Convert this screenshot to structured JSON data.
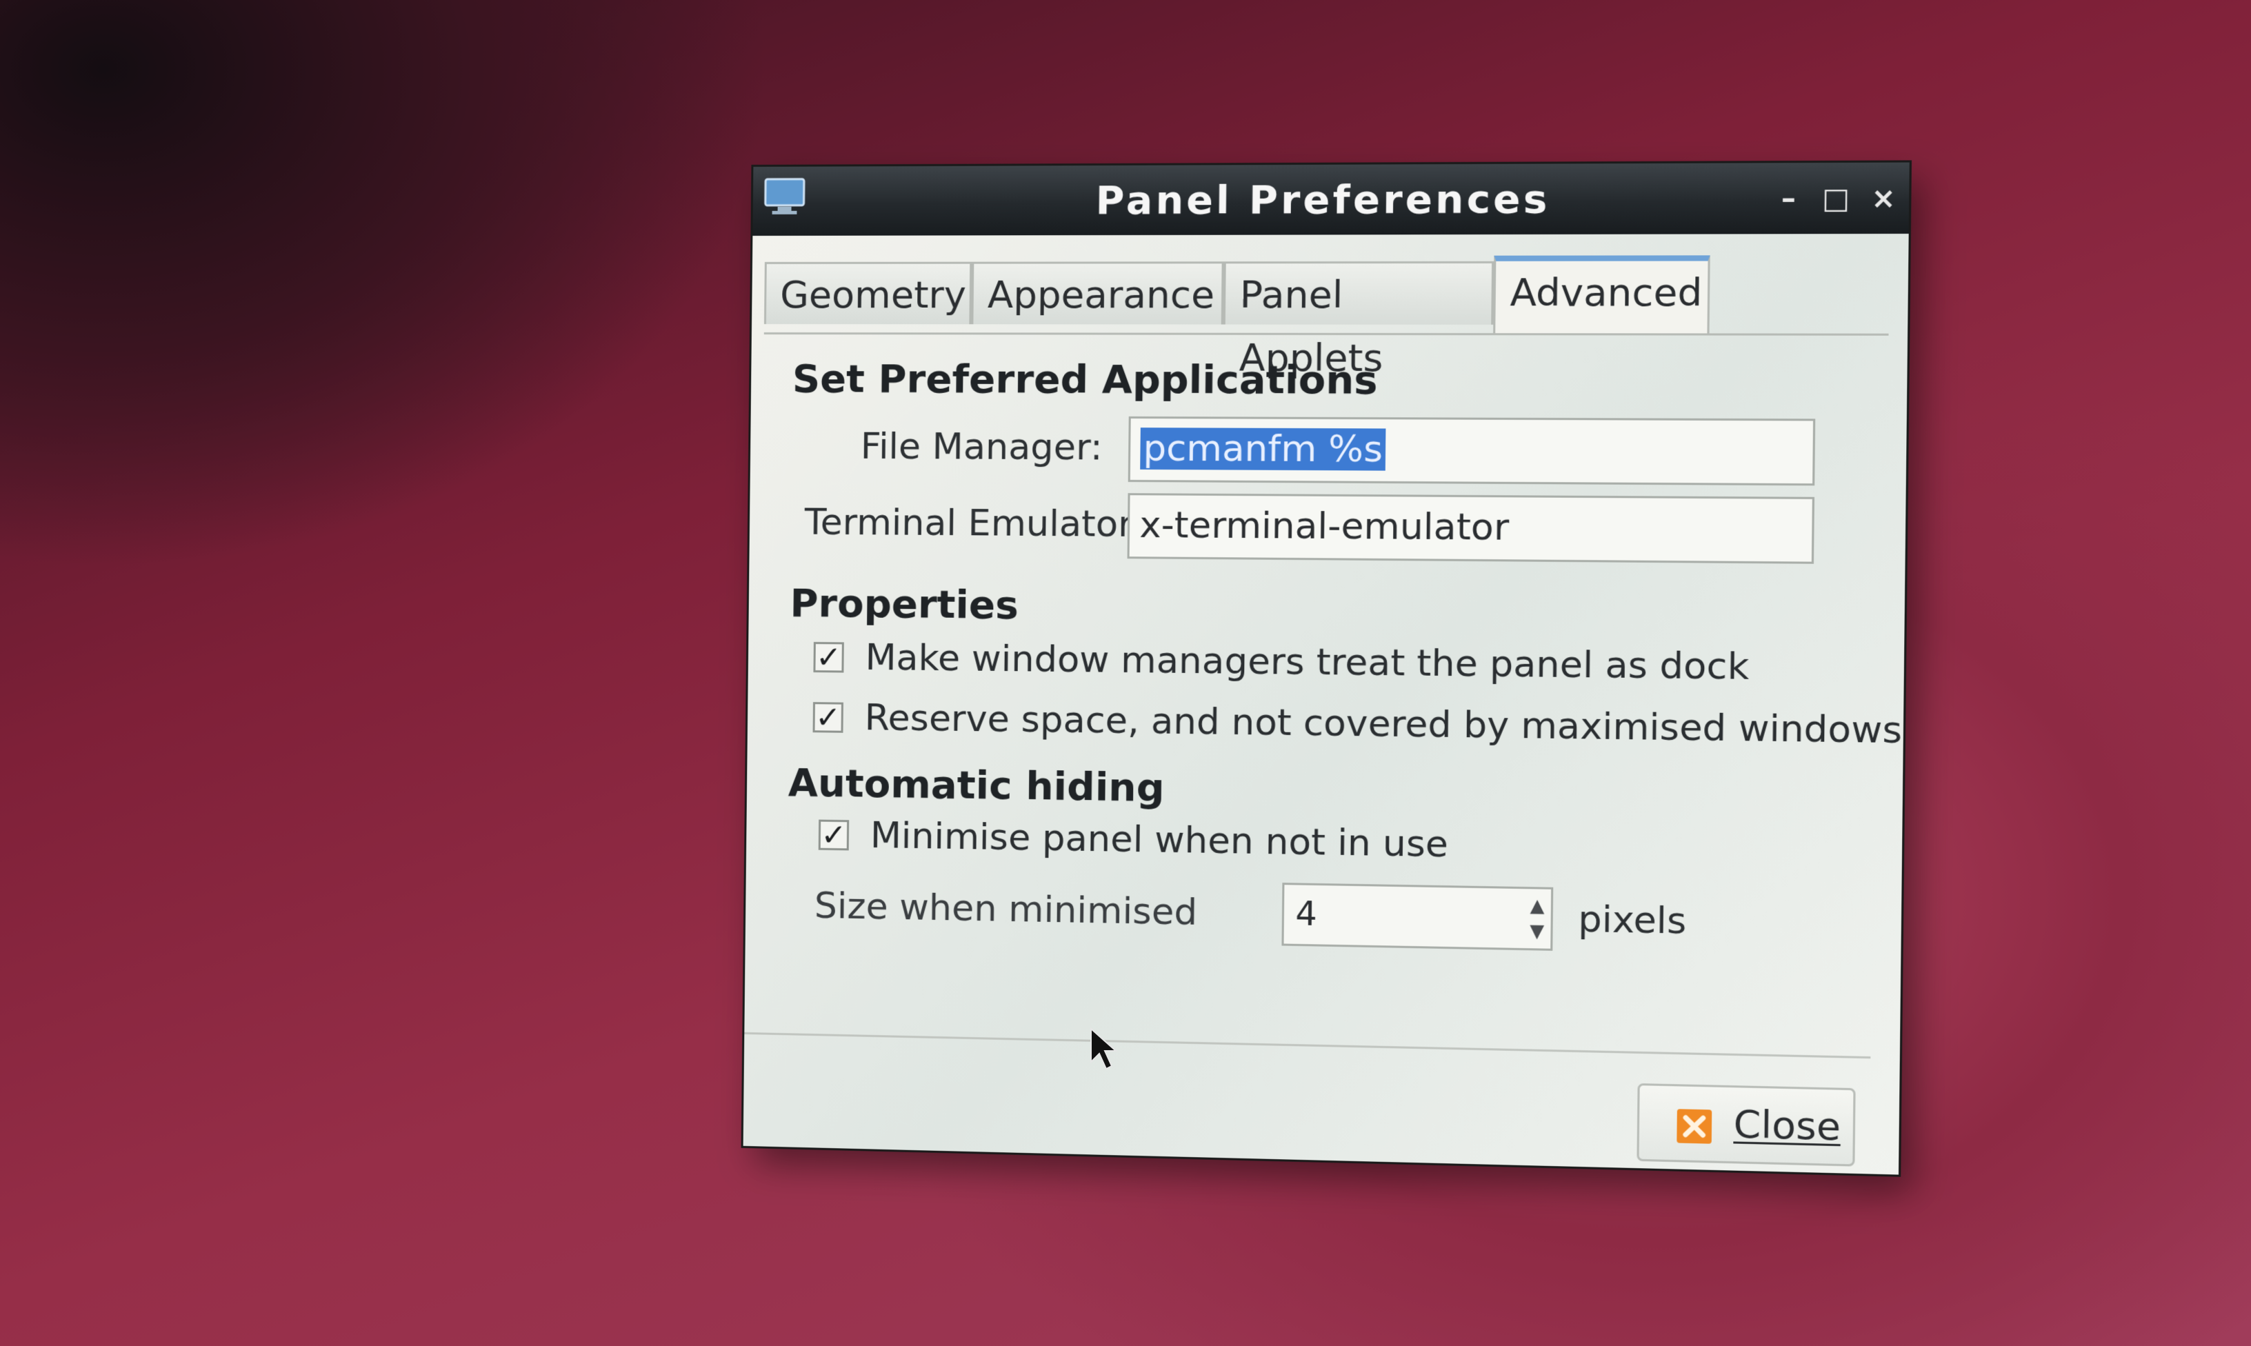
{
  "window": {
    "title": "Panel Preferences",
    "controls": {
      "minimize": "–",
      "maximize": "□",
      "close": "×"
    }
  },
  "tabs": [
    {
      "label": "Geometry",
      "active": false
    },
    {
      "label": "Appearance",
      "active": false
    },
    {
      "label": "Panel Applets",
      "active": false
    },
    {
      "label": "Advanced",
      "active": true
    }
  ],
  "preferred_apps": {
    "heading": "Set Preferred Applications",
    "file_manager_label": "File Manager:",
    "file_manager_value": "pcmanfm %s",
    "terminal_label": "Terminal Emulator:",
    "terminal_value": "x-terminal-emulator"
  },
  "properties": {
    "heading": "Properties",
    "dock_label": "Make window managers treat the panel as dock",
    "dock_checked": true,
    "reserve_label": "Reserve space, and not covered by maximised windows",
    "reserve_checked": true
  },
  "auto_hide": {
    "heading": "Automatic hiding",
    "minimise_label": "Minimise panel when not in use",
    "minimise_checked": true,
    "size_label": "Size when minimised",
    "size_value": "4",
    "size_unit": "pixels"
  },
  "buttons": {
    "close_label": "Close"
  },
  "colors": {
    "selection": "#3d7bd3",
    "active_tab_accent": "#6fa3d8",
    "close_icon": "#f08a24"
  },
  "icons": {
    "app": "monitor-icon",
    "close": "close-x-icon",
    "pointer": "mouse-cursor-icon"
  }
}
